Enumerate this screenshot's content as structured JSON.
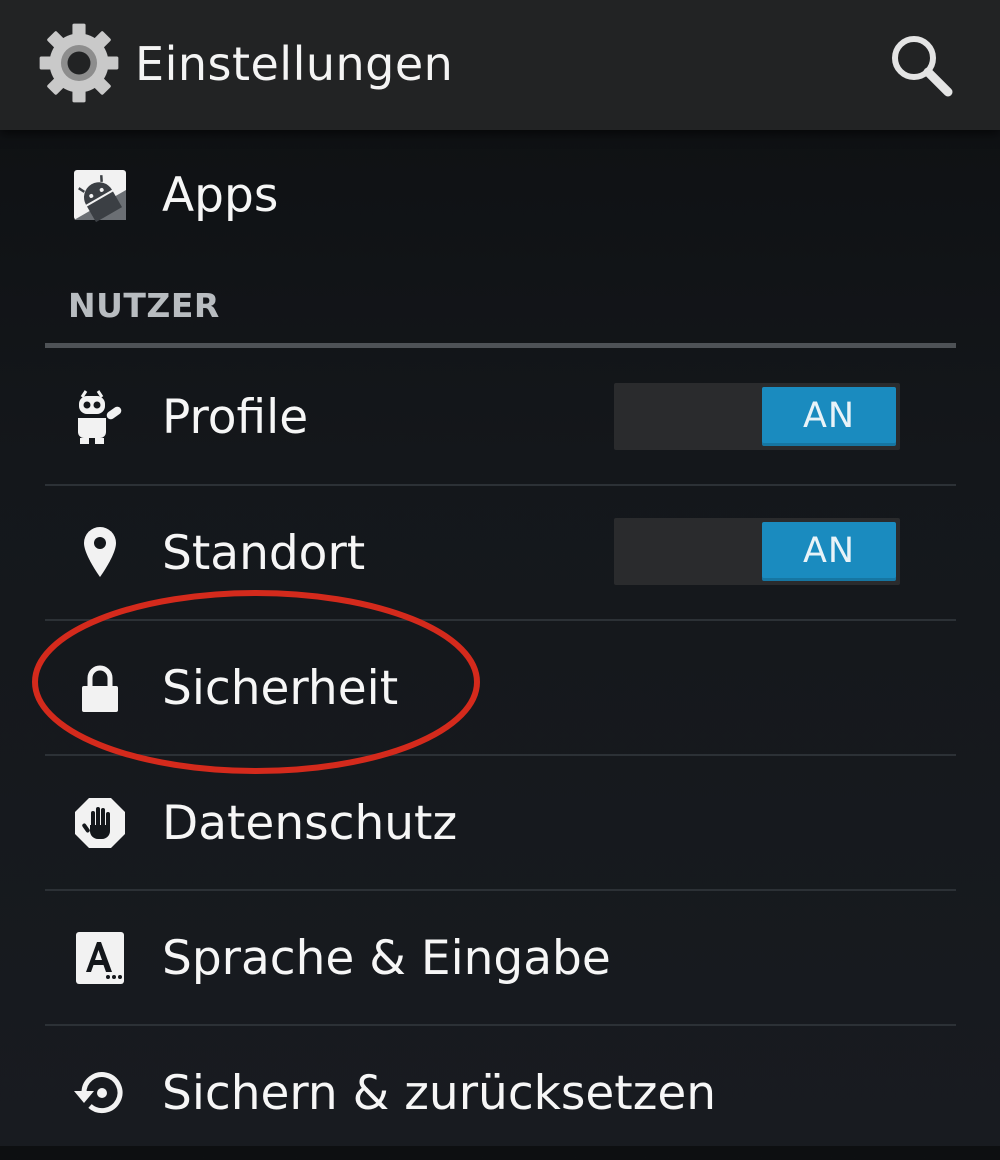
{
  "action_bar": {
    "title": "Einstellungen",
    "app_icon": "gear-icon",
    "search_icon": "search-icon"
  },
  "items": {
    "apps": {
      "label": "Apps",
      "icon": "android-apps-icon"
    },
    "profile": {
      "label": "Profile",
      "icon": "cyanogenmod-mascot-icon",
      "toggle": "AN"
    },
    "standort": {
      "label": "Standort",
      "icon": "location-pin-icon",
      "toggle": "AN"
    },
    "sicherheit": {
      "label": "Sicherheit",
      "icon": "lock-icon"
    },
    "datenschutz": {
      "label": "Datenschutz",
      "icon": "stop-hand-icon"
    },
    "sprache": {
      "label": "Sprache & Eingabe",
      "icon": "keyboard-letter-a-icon"
    },
    "sichern": {
      "label": "Sichern & zurücksetzen",
      "icon": "restore-icon"
    }
  },
  "section": {
    "nutzer": "NUTZER"
  },
  "colors": {
    "toggle_on": "#1a8bbf",
    "annotation": "#d42a1c",
    "action_bar": "#222324"
  }
}
